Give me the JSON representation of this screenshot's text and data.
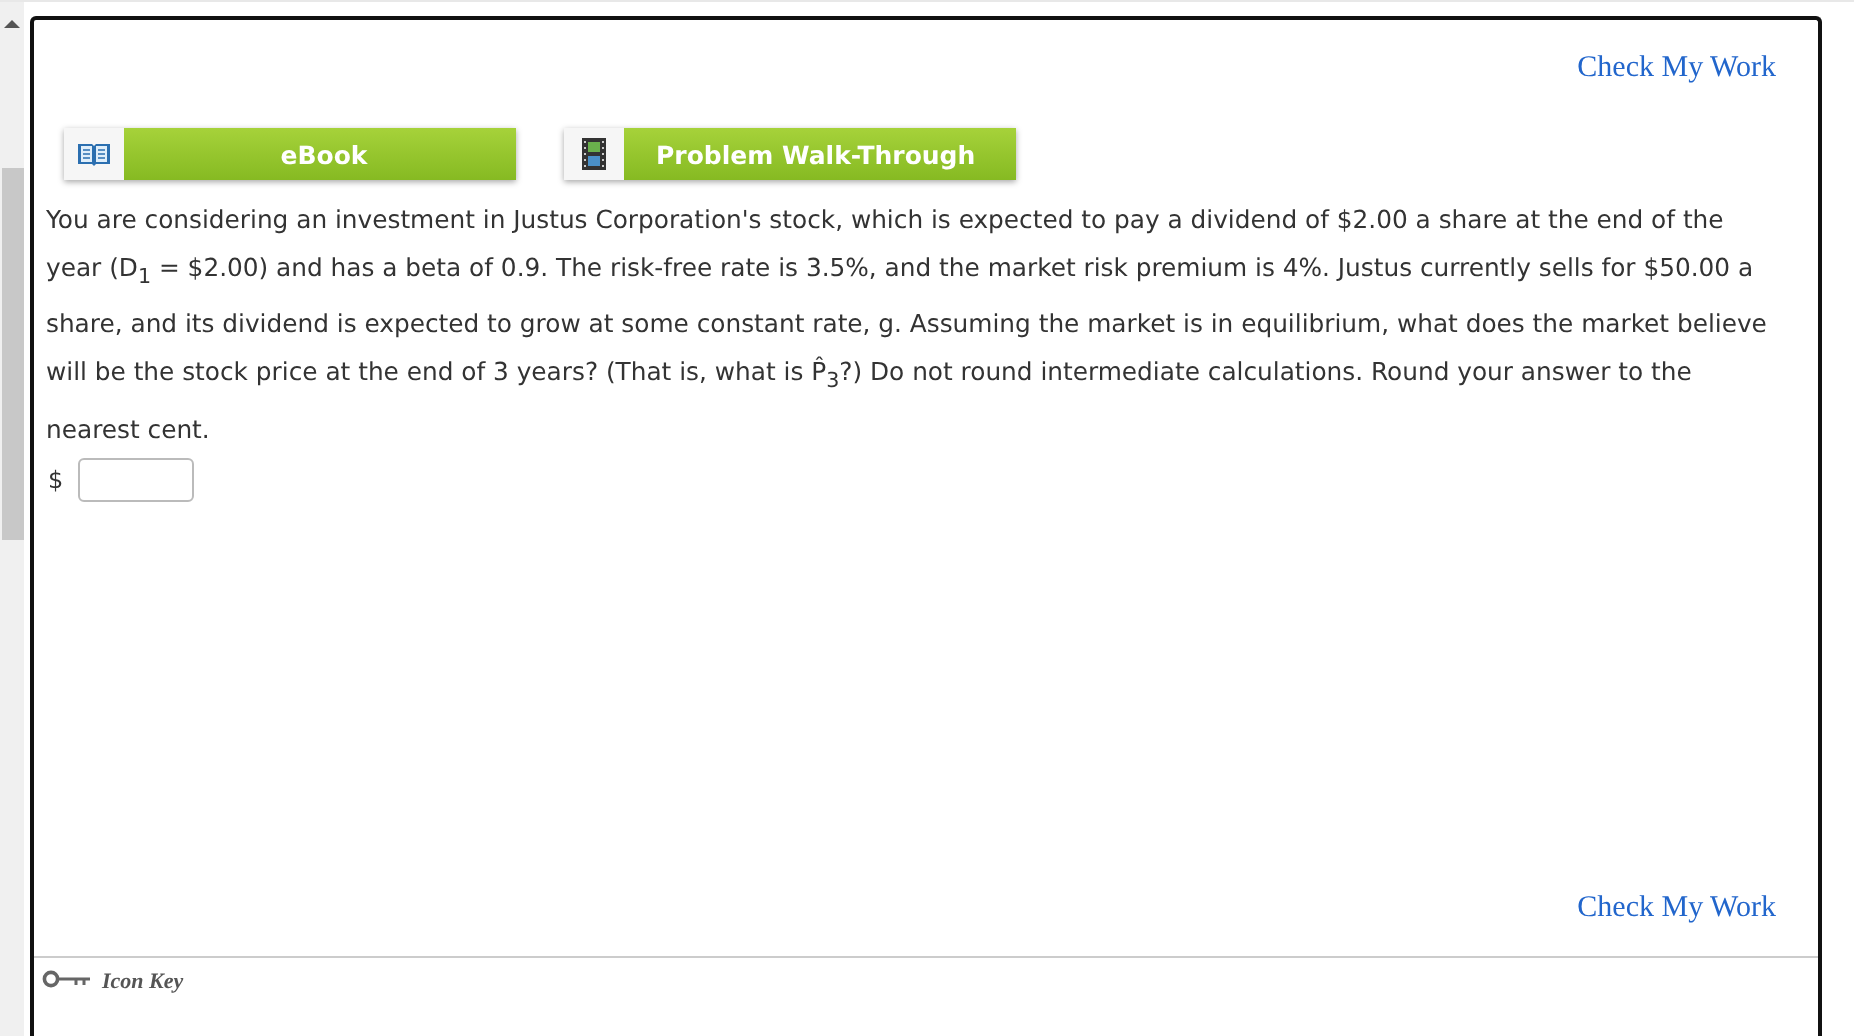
{
  "check_link_top": "Check My Work",
  "resources": [
    {
      "kind": "ebook",
      "label": "eBook"
    },
    {
      "kind": "video",
      "label": "Problem Walk-Through"
    }
  ],
  "question": "You are considering an investment in Justus Corporation's stock, which is expected to pay a dividend of $2.00 a share at the end of the year (D$_{1}$ = $2.00) and has a beta of 0.9. The risk-free rate is 3.5%, and the market risk premium is 4%. Justus currently sells for $50.00 a share, and its dividend is expected to grow at some constant rate, g. Assuming the market is in equilibrium, what does the market believe will be the stock price at the end of 3 years? (That is, what is P̂$_{3}$?) Do not round intermediate calculations. Round your answer to the nearest cent.",
  "answer": {
    "currency": "$"
  },
  "check_link_bottom": "Check My Work",
  "icon_key": "Icon Key"
}
